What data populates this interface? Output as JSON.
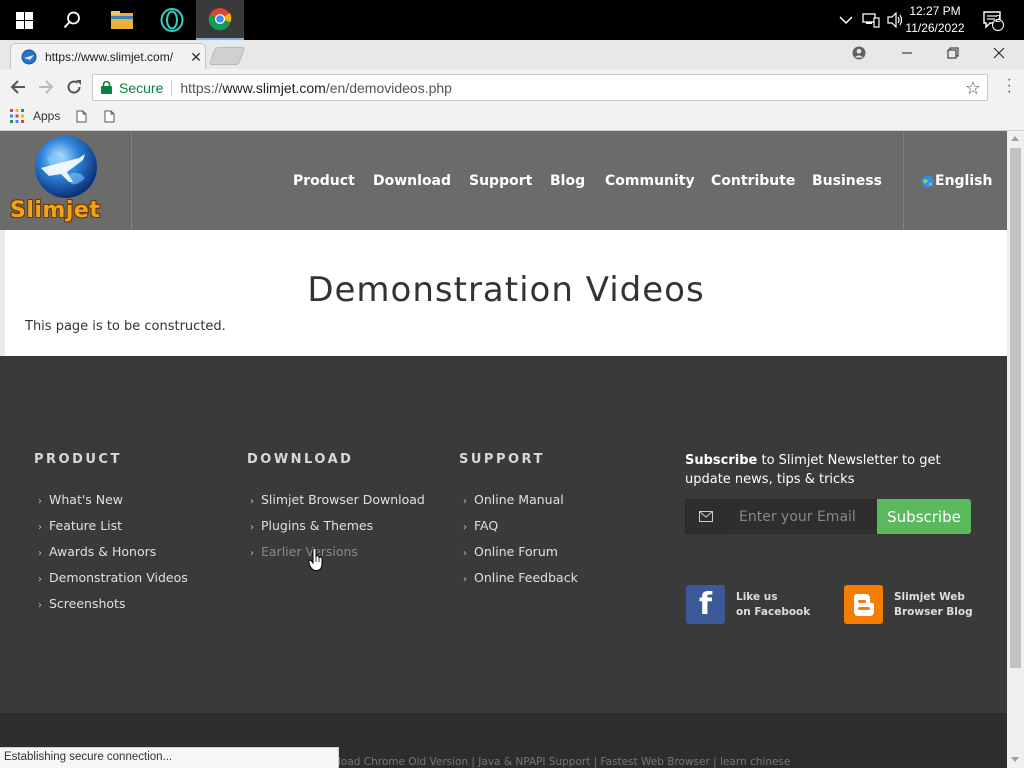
{
  "taskbar": {
    "time": "12:27 PM",
    "date": "11/26/2022",
    "notification_count": "2"
  },
  "browser": {
    "tab_title": "https://www.slimjet.com/",
    "secure_label": "Secure",
    "url_scheme": "https://",
    "url_host": "www.slimjet.com",
    "url_path": "/en/demovideos.php",
    "bookmarks_apps_label": "Apps",
    "status_text": "Establishing secure connection..."
  },
  "site": {
    "logo_text": "Slimjet",
    "nav": [
      "Product",
      "Download",
      "Support",
      "Blog",
      "Community",
      "Contribute",
      "Business"
    ],
    "language": "English"
  },
  "content": {
    "heading": "Demonstration Videos",
    "note": "This page is to be constructed."
  },
  "footer": {
    "product": {
      "heading": "PRODUCT",
      "links": [
        "What's New",
        "Feature List",
        "Awards & Honors",
        "Demonstration Videos",
        "Screenshots"
      ]
    },
    "download": {
      "heading": "DOWNLOAD",
      "links": [
        "Slimjet Browser Download",
        "Plugins & Themes",
        "Earlier Versions"
      ]
    },
    "support": {
      "heading": "SUPPORT",
      "links": [
        "Online Manual",
        "FAQ",
        "Online Forum",
        "Online Feedback"
      ]
    },
    "subscribe": {
      "bold": "Subscribe",
      "rest": " to Slimjet Newsletter to get update news, tips & tricks",
      "email_placeholder": "Enter your Email",
      "button_label": "Subscribe"
    },
    "social": {
      "facebook_line1": "Like us",
      "facebook_line2": "on Facebook",
      "blog_line1": "Slimjet Web",
      "blog_line2": "Browser Blog"
    },
    "bottom_links": "load Chrome Old Version | Java & NPAPI Support | Fastest Web Browser | learn chinese"
  },
  "colors": {
    "header_bg": "#6b6b6b",
    "footer_bg": "#3a3a3a",
    "subscribe_green": "#5cb85c",
    "secure_green": "#0b8043",
    "facebook_blue": "#3b5998",
    "blogger_orange": "#f57d00"
  }
}
